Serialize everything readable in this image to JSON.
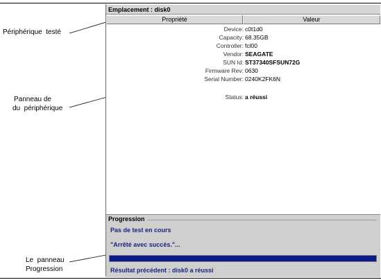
{
  "callouts": {
    "device_tested": "Périphérique  testé",
    "device_panel_line1": "Panneau de",
    "device_panel_line2": "du  périphérique",
    "progress_panel_line1": "Le  panneau",
    "progress_panel_line2": "Progression"
  },
  "window": {
    "location": "Emplacement : disk0",
    "columns": {
      "property": "Propriété",
      "value": "Valeur"
    },
    "properties": [
      {
        "name": "Device:",
        "value": "c0t1d0",
        "strong": false
      },
      {
        "name": "Capacity:",
        "value": "68.35GB",
        "strong": false
      },
      {
        "name": "Controller:",
        "value": "fcl00",
        "strong": false
      },
      {
        "name": "Vendor:",
        "value": "SEAGATE",
        "strong": true
      },
      {
        "name": "SUN Id:",
        "value": "ST37340SFSUN72G",
        "strong": true
      },
      {
        "name": "Firmware Rev:",
        "value": "0630",
        "strong": false
      },
      {
        "name": "Serial Number:",
        "value": "0240K2FK6N",
        "strong": false
      },
      {
        "name": "Status:",
        "value": "a réussi",
        "strong": true
      }
    ]
  },
  "progress": {
    "title": "Progression",
    "status_line": "Pas de test en cours",
    "message": "\"Arrêté avec succès.\"...",
    "fraction": 1.0,
    "result": "Résultat précédent : disk0 a réussi"
  },
  "colors": {
    "progress_fill": "#0a1a8c",
    "panel_background": "#cfcfcf"
  }
}
